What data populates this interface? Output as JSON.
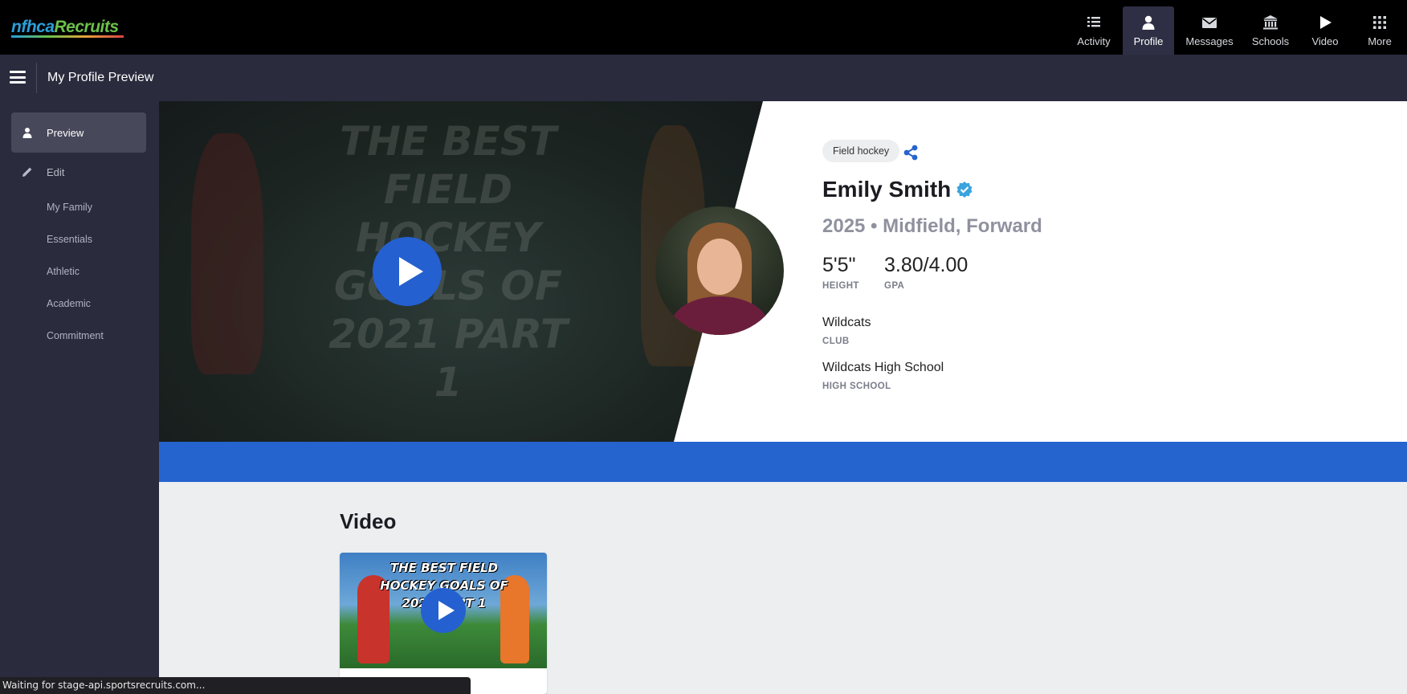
{
  "brand": {
    "logo_part1": "nfhca",
    "logo_part2": "Recruits"
  },
  "topnav": {
    "items": [
      {
        "label": "Activity",
        "icon": "list-icon",
        "active": false
      },
      {
        "label": "Profile",
        "icon": "person-icon",
        "active": true
      },
      {
        "label": "Messages",
        "icon": "envelope-icon",
        "active": false
      },
      {
        "label": "Schools",
        "icon": "institution-icon",
        "active": false
      },
      {
        "label": "Video",
        "icon": "play-icon",
        "active": false
      },
      {
        "label": "More",
        "icon": "grid-icon",
        "active": false
      }
    ]
  },
  "subbar": {
    "title": "My Profile Preview"
  },
  "sidebar": {
    "preview_label": "Preview",
    "edit_label": "Edit",
    "sub_items": [
      "My Family",
      "Essentials",
      "Athletic",
      "Academic",
      "Commitment"
    ]
  },
  "profile": {
    "sport_tag": "Field hockey",
    "name": "Emily Smith",
    "subtitle": "2025 • Midfield, Forward",
    "height_value": "5'5\"",
    "height_label": "HEIGHT",
    "gpa_value": "3.80/4.00",
    "gpa_label": "GPA",
    "club_value": "Wildcats",
    "club_label": "CLUB",
    "school_value": "Wildcats High School",
    "school_label": "HIGH SCHOOL"
  },
  "hero_video": {
    "thumbnail_text": "THE BEST FIELD HOCKEY GOALS OF 2021 PART 1"
  },
  "video_section": {
    "title": "Video",
    "card_thumbnail_text": "THE BEST FIELD HOCKEY GOALS OF 2021 PART 1"
  },
  "status": {
    "text": "Waiting for stage-api.sportsrecruits.com..."
  },
  "colors": {
    "accent": "#2563cf",
    "nav_bg": "#000000",
    "panel_bg": "#2a2b3d",
    "verified": "#3aa3dd"
  }
}
